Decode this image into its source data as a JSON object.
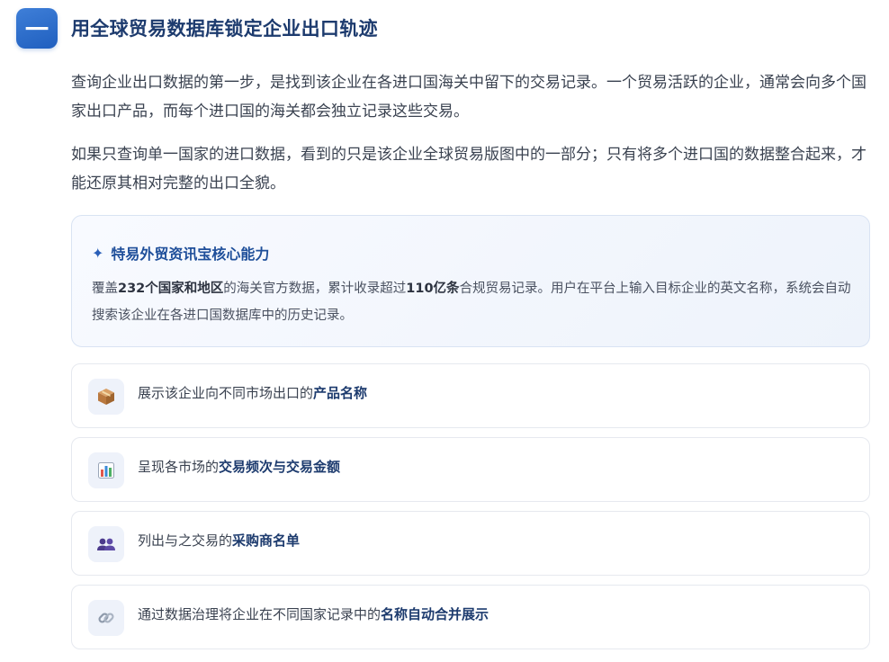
{
  "header": {
    "badge": "一",
    "title": "用全球贸易数据库锁定企业出口轨迹"
  },
  "paragraphs": [
    "查询企业出口数据的第一步，是找到该企业在各进口国海关中留下的交易记录。一个贸易活跃的企业，通常会向多个国家出口产品，而每个进口国的海关都会独立记录这些交易。",
    "如果只查询单一国家的进口数据，看到的只是该企业全球贸易版图中的一部分；只有将多个进口国的数据整合起来，才能还原其相对完整的出口全貌。"
  ],
  "core": {
    "icon": "sparkle-icon",
    "title": "特易外贸资讯宝核心能力",
    "text_1": "覆盖",
    "bold_1": "232个国家和地区",
    "text_2": "的海关官方数据，累计收录超过",
    "bold_2": "110亿条",
    "text_3": "合规贸易记录。用户在平台上输入目标企业的英文名称，系统会自动搜索该企业在各进口国数据库中的历史记录。"
  },
  "features": [
    {
      "icon": "package-icon",
      "text": "展示该企业向不同市场出口的",
      "bold": "产品名称"
    },
    {
      "icon": "bar-chart-icon",
      "text": "呈现各市场的",
      "bold": "交易频次与交易金额"
    },
    {
      "icon": "people-icon",
      "text": "列出与之交易的",
      "bold": "采购商名单"
    },
    {
      "icon": "link-icon",
      "text": "通过数据治理将企业在不同国家记录中的",
      "bold": "名称自动合并展示"
    }
  ],
  "colors": {
    "accent": "#1f5fbf",
    "title": "#1d3b6e",
    "box_border": "#d9e3f3"
  }
}
